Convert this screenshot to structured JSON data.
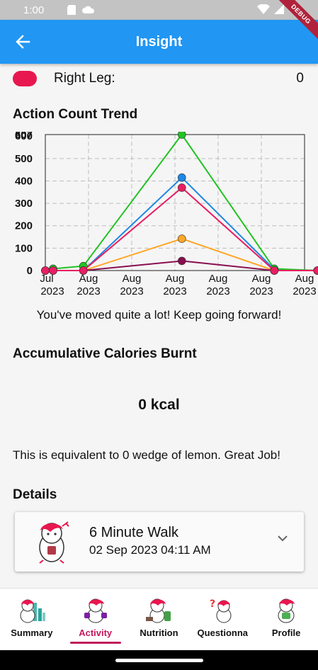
{
  "status": {
    "time": "1:00"
  },
  "debug_label": "DEBUG",
  "app_bar": {
    "title": "Insight"
  },
  "right_leg": {
    "label": "Right Leg:",
    "value": "0",
    "color": "#e9174f"
  },
  "trend": {
    "title": "Action Count Trend",
    "message": "You've moved quite a lot! Keep going forward!"
  },
  "chart_data": {
    "type": "line",
    "title": "Action Count Trend",
    "xlabel": "",
    "ylabel": "",
    "ylim": [
      0,
      607
    ],
    "y_ticks": [
      "0",
      "100",
      "200",
      "300",
      "400",
      "500",
      "600",
      "607"
    ],
    "x_ticks": [
      {
        "line1": "Jul",
        "line2": "2023"
      },
      {
        "line1": "Aug",
        "line2": "2023"
      },
      {
        "line1": "Aug",
        "line2": "2023"
      },
      {
        "line1": "Aug",
        "line2": "2023"
      },
      {
        "line1": "Aug",
        "line2": "2023"
      },
      {
        "line1": "Aug",
        "line2": "2023"
      },
      {
        "line1": "Aug",
        "line2": "2023"
      }
    ],
    "x": [
      0,
      0.18,
      0.88,
      3.16,
      5.3,
      6.3
    ],
    "grid": true,
    "series": [
      {
        "color": "#1e88e5",
        "values": [
          0,
          0,
          0,
          415,
          5,
          0
        ]
      },
      {
        "color": "#22c322",
        "values": [
          0,
          8,
          20,
          607,
          8,
          0
        ]
      },
      {
        "color": "#ffa726",
        "values": [
          0,
          0,
          0,
          142,
          0,
          0
        ]
      },
      {
        "color": "#880e4f",
        "values": [
          0,
          0,
          0,
          43,
          0,
          0
        ]
      },
      {
        "color": "#e91e63",
        "values": [
          0,
          0,
          0,
          370,
          0,
          0
        ]
      }
    ]
  },
  "calories": {
    "title": "Accumulative Calories Burnt",
    "value": "0 kcal",
    "equivalent": "This is equivalent to 0 wedge of lemon. Great Job!"
  },
  "details": {
    "title": "Details",
    "items": [
      {
        "name": "6 Minute Walk",
        "date": "02 Sep 2023 04:11 AM"
      }
    ]
  },
  "bottom_nav": {
    "items": [
      {
        "label": "Summary"
      },
      {
        "label": "Activity"
      },
      {
        "label": "Nutrition"
      },
      {
        "label": "Questionna"
      },
      {
        "label": "Profile"
      }
    ],
    "active": "Activity",
    "accent": "#c2185b"
  }
}
